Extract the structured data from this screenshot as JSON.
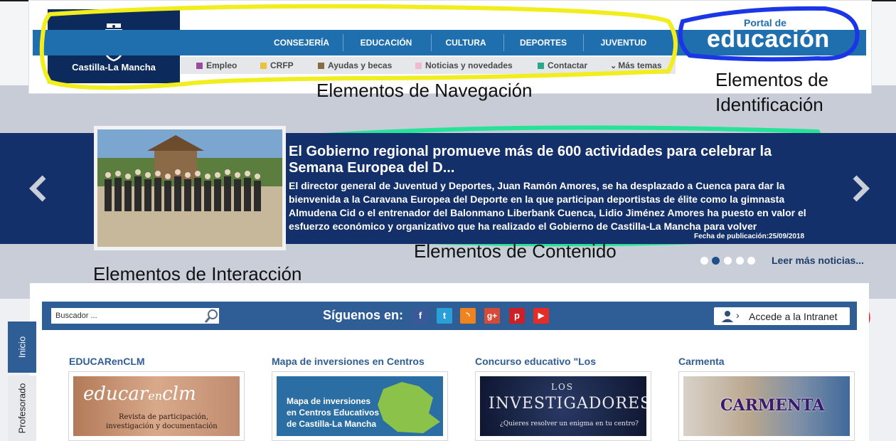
{
  "brand": {
    "logo_text": "Castilla-La Mancha",
    "portal_small": "Portal de",
    "portal_big": "educación"
  },
  "nav": {
    "main": [
      "CONSEJERÍA",
      "EDUCACIÓN",
      "CULTURA",
      "DEPORTES",
      "JUVENTUD"
    ],
    "sub": [
      {
        "label": "Empleo",
        "color": "#9b4aa0"
      },
      {
        "label": "CRFP",
        "color": "#e8c23a"
      },
      {
        "label": "Ayudas y becas",
        "color": "#8a6a45"
      },
      {
        "label": "Noticias y novedades",
        "color": "#f0b9d0"
      },
      {
        "label": "Contactar",
        "color": "#2aa88e"
      },
      {
        "label": "Más temas",
        "color": ""
      }
    ]
  },
  "annotations": {
    "navigation": "Elementos de Navegación",
    "identification_1": "Elementos de",
    "identification_2": "Identificación",
    "content": "Elementos de Contenido",
    "interaction": "Elementos de Interacción"
  },
  "news": {
    "title": "El Gobierno regional promueve más de 600 actividades para celebrar la Semana Europea del D...",
    "body": "El director general de Juventud y Deportes, Juan Ramón Amores, se ha desplazado a Cuenca para dar la bienvenida a la Caravana Europea del Deporte en la que participan deportistas de élite como la gimnasta Almudena Cid o el entrenador del Balonmano Liberbank Cuenca, Lidio Jiménez   Amores ha puesto en valor el esfuerzo económico y organizativo que ha realizado el Gobierno de Castilla-La Mancha para volver",
    "date": "Fecha de publicación:25/09/2018",
    "more": "Leer más noticias...",
    "slide_count": 5,
    "active_slide": 2
  },
  "interaction": {
    "search_placeholder": "Buscador ...",
    "follow_label": "Síguenos en:",
    "social": [
      {
        "icon": "facebook-icon",
        "glyph": "f",
        "color": "#3b5998"
      },
      {
        "icon": "twitter-icon",
        "glyph": "t",
        "color": "#2a9fd8"
      },
      {
        "icon": "rss-icon",
        "glyph": "◝",
        "color": "#f0831e"
      },
      {
        "icon": "google-plus-icon",
        "glyph": "g+",
        "color": "#d84a38"
      },
      {
        "icon": "pinterest-icon",
        "glyph": "p",
        "color": "#cb2027"
      },
      {
        "icon": "youtube-icon",
        "glyph": "▶",
        "color": "#e52d27"
      }
    ],
    "intranet_label": "Accede a la Intranet"
  },
  "side_tabs": [
    "Inicio",
    "Profesorado"
  ],
  "cards": [
    {
      "title": "EDUCARenCLM",
      "img_line1": "educar",
      "img_line1b": "en",
      "img_line1c": "clm",
      "img_line2": "Revista de participación,",
      "img_line3": "investigación y documentación"
    },
    {
      "title": "Mapa de inversiones en Centros",
      "img_line1": "Mapa de inversiones",
      "img_line2": "en Centros Educativos",
      "img_line3": "de Castilla-La Mancha"
    },
    {
      "title": "Concurso educativo \"Los",
      "img_line1": "LOS",
      "img_line2": "INVESTIGADORES",
      "img_line3": "¿Quieres resolver un enigma en tu centro?"
    },
    {
      "title": "Carmenta",
      "img_line1": "CARMENTA"
    }
  ],
  "colors": {
    "annot_yellow": "#f2ee1e",
    "annot_blue": "#1a36e6",
    "annot_green": "#27e39a",
    "annot_red": "#f01a1a"
  }
}
